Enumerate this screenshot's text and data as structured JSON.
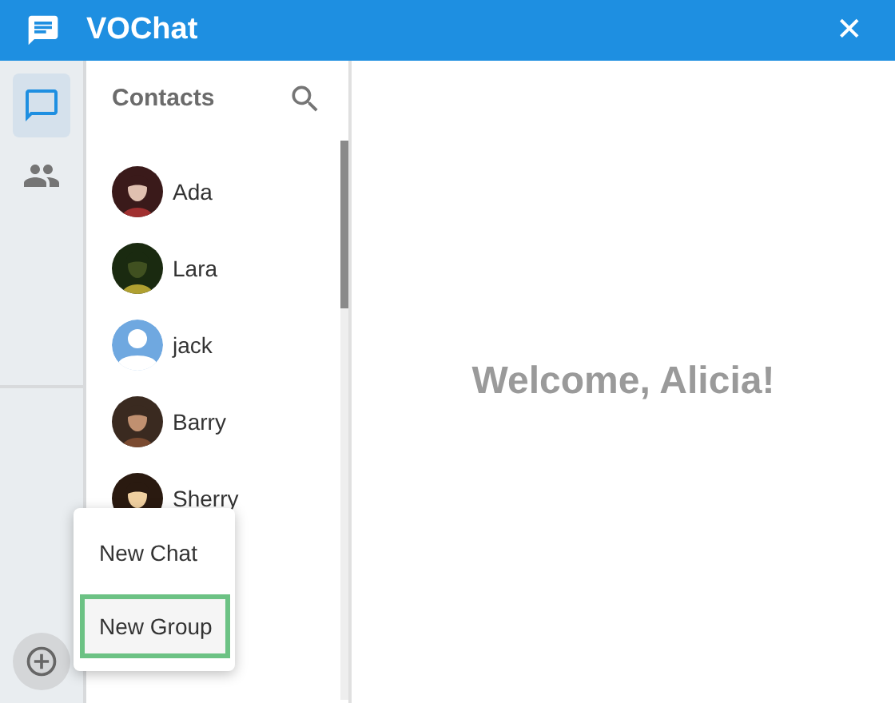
{
  "window": {
    "title": "VOChat",
    "close": "✕"
  },
  "rail": {
    "items": [
      {
        "kind": "chats",
        "selected": true
      },
      {
        "kind": "contacts",
        "selected": false
      }
    ]
  },
  "contacts": {
    "title": "Contacts",
    "items": [
      {
        "name": "Ada",
        "kind": "picture"
      },
      {
        "name": "Lara",
        "kind": "picture"
      },
      {
        "name": "jack",
        "kind": "default"
      },
      {
        "name": "Barry",
        "kind": "picture"
      },
      {
        "name": "Sherry",
        "kind": "picture"
      }
    ]
  },
  "main": {
    "welcome": "Welcome, Alicia!"
  },
  "menu": {
    "items": [
      {
        "label": "New Chat",
        "selected": false
      },
      {
        "label": "New Group",
        "selected": true
      }
    ]
  }
}
